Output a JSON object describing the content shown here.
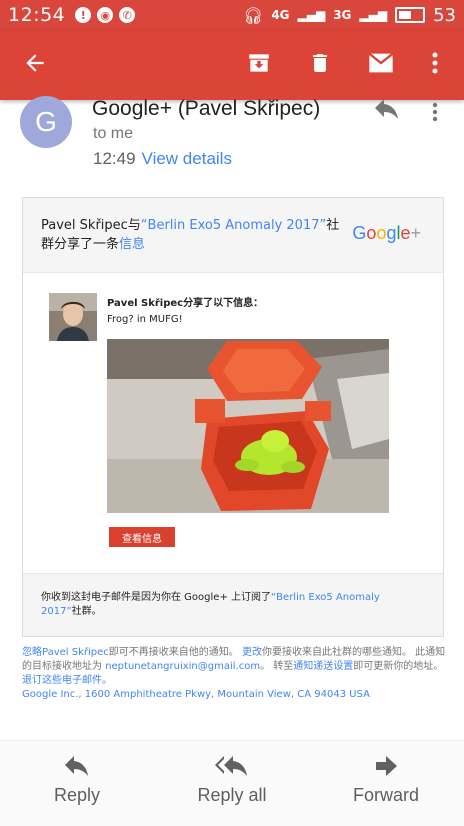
{
  "status_bar": {
    "time": "12:54",
    "signal_left": "4G",
    "signal_right": "3G",
    "battery": "53"
  },
  "app_bar": {
    "back_icon": "arrow-left-icon",
    "archive_icon": "archive-icon",
    "delete_icon": "trash-icon",
    "mail_icon": "envelope-icon",
    "more_icon": "more-vert-icon",
    "color": "#db4437"
  },
  "message": {
    "avatar_letter": "G",
    "sender": "Google+ (Pavel Skřipec)",
    "to": "to me",
    "time": "12:49",
    "view_details": "View details"
  },
  "card": {
    "header_prefix": "Pavel Skřipec与",
    "header_link": "“Berlin Exo5 Anomaly 2017”",
    "header_middle": "社群分享了一条",
    "header_link2": "信息",
    "logo": "Google+",
    "sharer": "Pavel Skřipec分享了以下信息：",
    "post_text": "Frog? in MUFG!",
    "view_button": "查看信息",
    "footer_prefix": "你收到这封电子邮件是因为你在 Google+ 上订阅了",
    "footer_link": "“Berlin Exo5 Anomaly 2017”",
    "footer_suffix": "社群。"
  },
  "below": {
    "ignore_link": "忽略Pavel Skřipec",
    "ignore_text": "即可不再接收来自他的通知。",
    "change_link": "更改",
    "change_text": "你要接收来自此社群的哪些通知。 此通知的目标接收地址为 ",
    "email": "neptunetangruixin@gmail.com",
    "goto_text": "。 转至",
    "settings_link": "通知递送设置",
    "settings_text": "即可更新你的地址。 ",
    "unsubscribe_link": "退订这些电子邮件",
    "unsubscribe_text": "。",
    "address": "Google Inc., 1600 Amphitheatre Pkwy, Mountain View, CA 94043 USA"
  },
  "actions": {
    "reply": "Reply",
    "reply_all": "Reply all",
    "forward": "Forward"
  }
}
